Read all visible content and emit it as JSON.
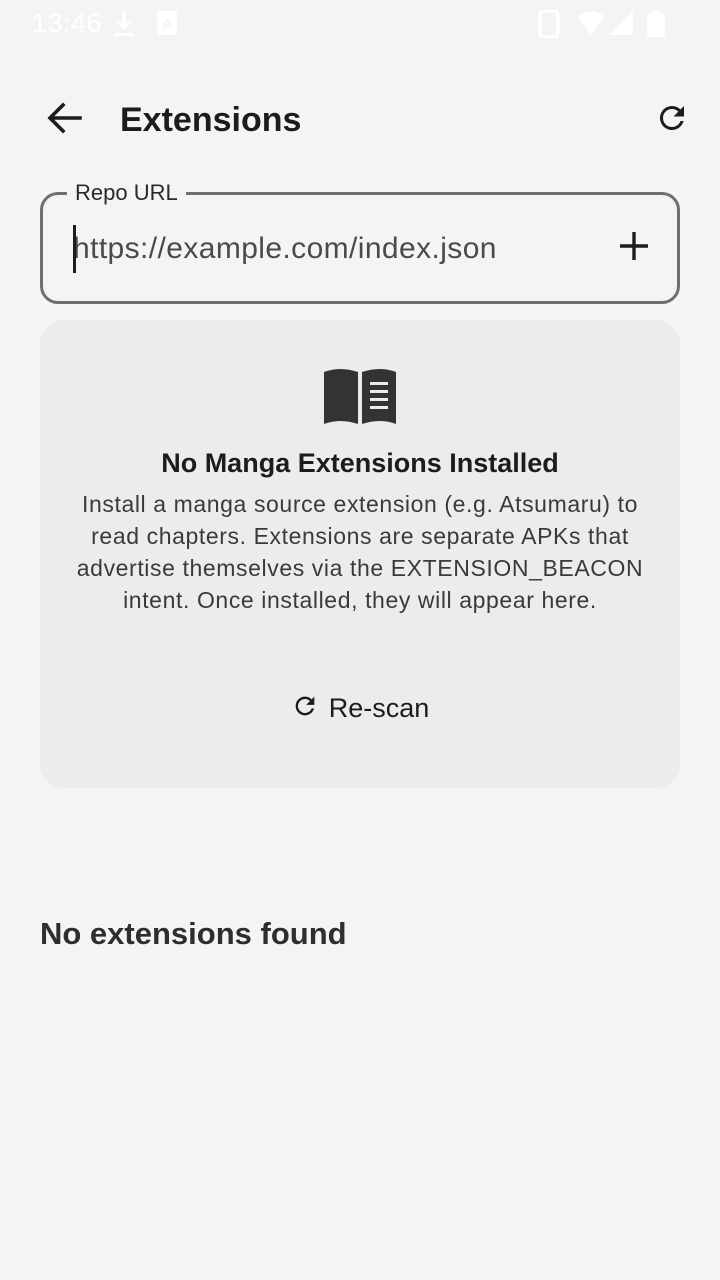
{
  "status_bar": {
    "time": "13:46",
    "icons": [
      "download-icon",
      "a-badge-icon",
      "phone-icon",
      "wifi-icon",
      "signal-icon",
      "battery-icon"
    ]
  },
  "app_bar": {
    "title": "Extensions",
    "back_icon": "arrow-back-icon",
    "refresh_icon": "refresh-icon"
  },
  "repo_field": {
    "label": "Repo URL",
    "placeholder": "https://example.com/index.json",
    "value": "",
    "add_icon": "plus-icon"
  },
  "empty_card": {
    "icon": "book-icon",
    "title": "No Manga Extensions Installed",
    "body": "Install a manga source extension (e.g. Atsumaru) to read chapters. Extensions are separate APKs that advertise themselves via the EXTENSION_BEACON intent. Once installed, they will appear here.",
    "button_label": "Re-scan",
    "button_icon": "refresh-icon"
  },
  "list": {
    "empty_text": "No extensions found"
  },
  "colors": {
    "background": "#f4f4f4",
    "card": "#ececec",
    "outline": "#6f6f6f",
    "text": "#1c1c1c"
  }
}
